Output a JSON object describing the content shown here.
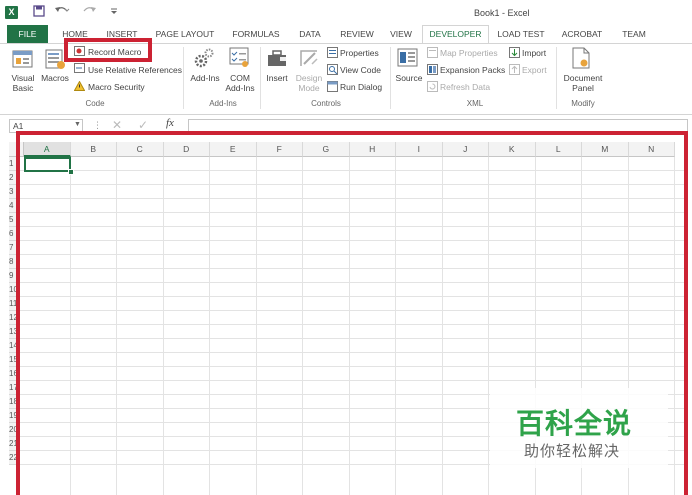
{
  "window": {
    "title": "Book1 - Excel"
  },
  "app": {
    "logo_letter": "X"
  },
  "tabs": [
    {
      "label": "FILE"
    },
    {
      "label": "HOME"
    },
    {
      "label": "INSERT"
    },
    {
      "label": "PAGE LAYOUT"
    },
    {
      "label": "FORMULAS"
    },
    {
      "label": "DATA"
    },
    {
      "label": "REVIEW"
    },
    {
      "label": "VIEW"
    },
    {
      "label": "DEVELOPER"
    },
    {
      "label": "LOAD TEST"
    },
    {
      "label": "ACROBAT"
    },
    {
      "label": "TEAM"
    }
  ],
  "ribbon": {
    "code": {
      "label": "Code",
      "visual_basic": "Visual Basic",
      "macros": "Macros",
      "record_macro": "Record Macro",
      "use_relative": "Use Relative References",
      "macro_security": "Macro Security"
    },
    "addins": {
      "label": "Add-Ins",
      "add_ins": "Add-Ins",
      "com_add_ins": "COM Add-Ins"
    },
    "controls": {
      "label": "Controls",
      "insert": "Insert",
      "design_mode": "Design Mode",
      "properties": "Properties",
      "view_code": "View Code",
      "run_dialog": "Run Dialog"
    },
    "xml": {
      "label": "XML",
      "source": "Source",
      "map_properties": "Map Properties",
      "expansion_packs": "Expansion Packs",
      "refresh_data": "Refresh Data",
      "import": "Import",
      "export": "Export"
    },
    "modify": {
      "label": "Modify",
      "document_panel": "Document Panel"
    }
  },
  "formula_bar": {
    "name_box": "A1",
    "fx": "fx",
    "cancel": "✕",
    "enter": "✓"
  },
  "columns": [
    "A",
    "B",
    "C",
    "D",
    "E",
    "F",
    "G",
    "H",
    "I",
    "J",
    "K",
    "L",
    "M",
    "N"
  ],
  "selected_column": "A",
  "rows": [
    "1",
    "2",
    "3",
    "4",
    "5",
    "6",
    "7",
    "8",
    "9",
    "10",
    "11",
    "12",
    "13",
    "14",
    "15",
    "16",
    "17",
    "18",
    "19",
    "20",
    "21",
    "22"
  ],
  "watermark": {
    "line1": "百科全说",
    "line2": "助你轻松解决"
  },
  "colors": {
    "accent": "#217346",
    "highlight": "#cc2233",
    "watermark": "#2fa34a"
  }
}
